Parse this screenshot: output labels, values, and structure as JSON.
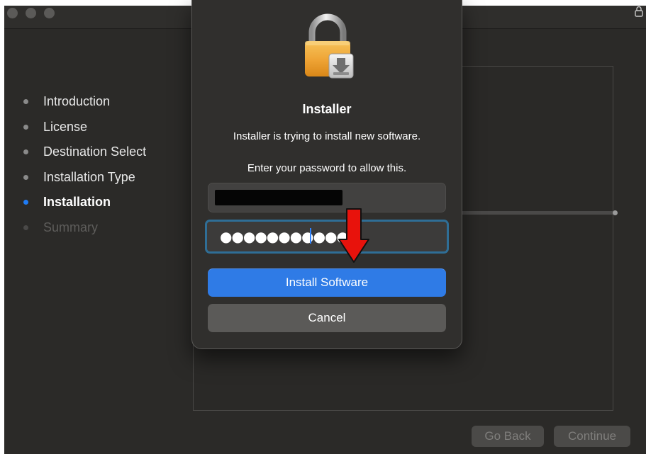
{
  "steps": [
    {
      "label": "Introduction",
      "state": "done"
    },
    {
      "label": "License",
      "state": "done"
    },
    {
      "label": "Destination Select",
      "state": "done"
    },
    {
      "label": "Installation Type",
      "state": "done"
    },
    {
      "label": "Installation",
      "state": "active"
    },
    {
      "label": "Summary",
      "state": "pending"
    }
  ],
  "footer": {
    "back_label": "Go Back",
    "continue_label": "Continue"
  },
  "dialog": {
    "icon": "installer-lock-icon",
    "title": "Installer",
    "message": "Installer is trying to install new software.",
    "prompt": "Enter your password to allow this.",
    "username_value": "",
    "password_mask": "●●●●●●●●●●●",
    "install_label": "Install Software",
    "cancel_label": "Cancel"
  },
  "colors": {
    "accent": "#2f7be6",
    "active_step": "#1f7cf5",
    "annotation_arrow": "#e8120c"
  }
}
